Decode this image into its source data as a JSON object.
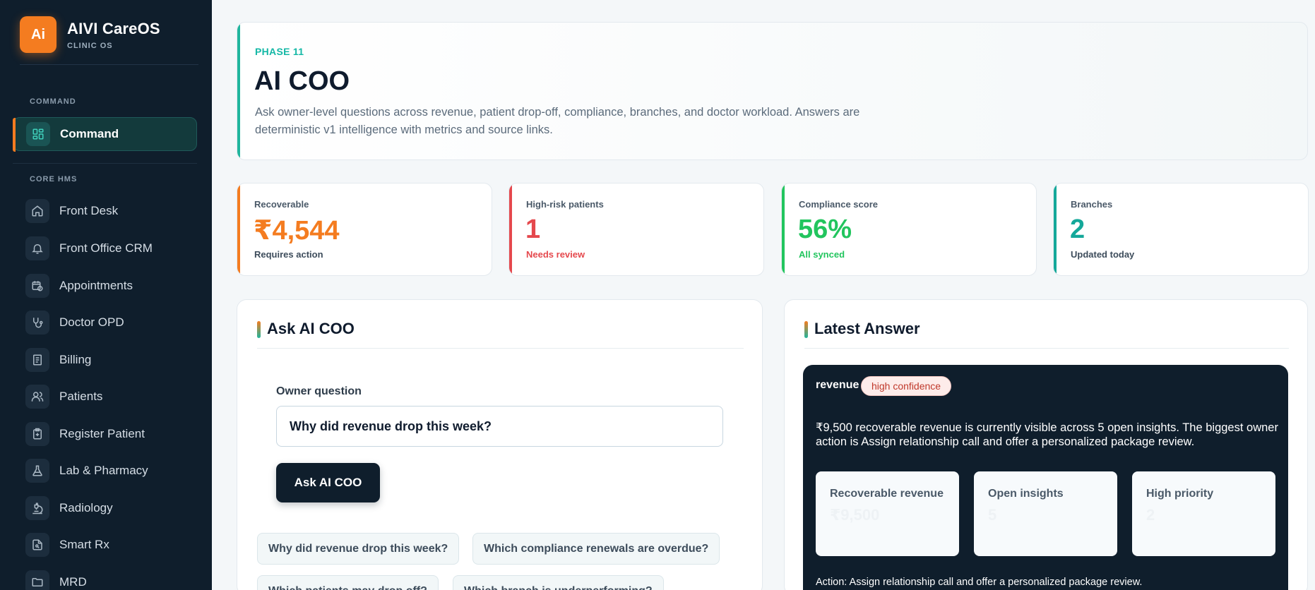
{
  "brand": {
    "logo": "Ai",
    "name": "AIVI CareOS",
    "sub": "CLINIC OS"
  },
  "sidebar": {
    "sections": [
      {
        "label": "COMMAND"
      },
      {
        "label": "CORE HMS"
      }
    ],
    "items": [
      {
        "label": "Command",
        "icon": "grid-icon",
        "active": true
      },
      {
        "label": "Front Desk",
        "icon": "home-icon"
      },
      {
        "label": "Front Office CRM",
        "icon": "bell-icon"
      },
      {
        "label": "Appointments",
        "icon": "calendar-clock-icon"
      },
      {
        "label": "Doctor OPD",
        "icon": "stethoscope-icon"
      },
      {
        "label": "Billing",
        "icon": "receipt-icon"
      },
      {
        "label": "Patients",
        "icon": "users-icon"
      },
      {
        "label": "Register Patient",
        "icon": "clipboard-plus-icon"
      },
      {
        "label": "Lab & Pharmacy",
        "icon": "flask-icon"
      },
      {
        "label": "Radiology",
        "icon": "microscope-icon"
      },
      {
        "label": "Smart Rx",
        "icon": "file-scan-icon"
      },
      {
        "label": "MRD",
        "icon": "folder-icon"
      }
    ]
  },
  "hero": {
    "phase": "PHASE 11",
    "title": "AI COO",
    "description": "Ask owner-level questions across revenue, patient drop-off, compliance, branches, and doctor workload. Answers are deterministic v1 intelligence with metrics and source links."
  },
  "stats": [
    {
      "label": "Recoverable",
      "value": "₹4,544",
      "sub": "Requires action",
      "color": "#f47c20",
      "sub_color": "#3d4c5b"
    },
    {
      "label": "High-risk patients",
      "value": "1",
      "sub": "Needs review",
      "color": "#e5484d",
      "sub_color": "#e5484d"
    },
    {
      "label": "Compliance score",
      "value": "56%",
      "sub": "All synced",
      "color": "#22c55e",
      "sub_color": "#22c55e"
    },
    {
      "label": "Branches",
      "value": "2",
      "sub": "Updated today",
      "color": "#14a89a",
      "sub_color": "#3d4c5b"
    }
  ],
  "ask": {
    "title": "Ask AI COO",
    "question_label": "Owner question",
    "question_value": "Why did revenue drop this week?",
    "button": "Ask AI COO",
    "suggestions": [
      "Why did revenue drop this week?",
      "Which compliance renewals are overdue?",
      "Which patients may drop off?",
      "Which branch is underperforming?"
    ]
  },
  "answer": {
    "title": "Latest Answer",
    "topic": "revenue",
    "confidence": "high confidence",
    "text": "₹9,500 recoverable revenue is currently visible across 5 open insights. The biggest owner action is Assign relationship call and offer a personalized package review.",
    "metrics": [
      {
        "label": "Recoverable revenue",
        "value": "₹9,500"
      },
      {
        "label": "Open insights",
        "value": "5"
      },
      {
        "label": "High priority",
        "value": "2"
      }
    ],
    "action": "Action: Assign relationship call and offer a personalized package review."
  }
}
